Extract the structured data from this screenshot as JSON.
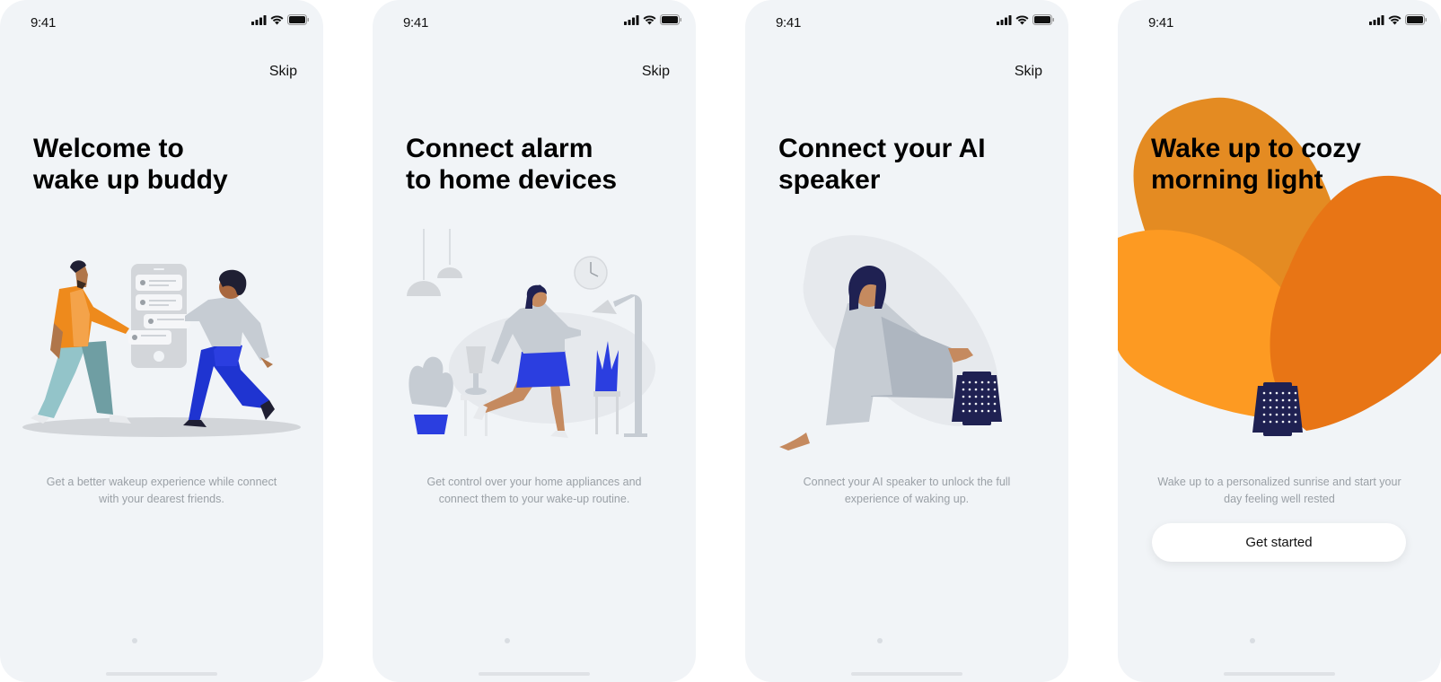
{
  "screens": [
    {
      "time": "9:41",
      "skip": "Skip",
      "title_line1": "Welcome to",
      "title_line2": "wake up buddy",
      "description": "Get a better wakeup experience while connect with your dearest friends.",
      "illustration": "people-exchanging-messages"
    },
    {
      "time": "9:41",
      "skip": "Skip",
      "title_line1": "Connect alarm",
      "title_line2": "to home devices",
      "description": "Get control over your home appliances and connect them to your wake-up routine.",
      "illustration": "woman-in-smart-home"
    },
    {
      "time": "9:41",
      "skip": "Skip",
      "title_line1": "Connect your AI",
      "title_line2": "speaker",
      "description": "Connect your AI speaker to unlock the full experience of waking up.",
      "illustration": "woman-reaching-speaker"
    },
    {
      "time": "9:41",
      "title_line1": "Wake up to cozy",
      "title_line2": "morning light",
      "description": "Wake up to a personalized sunrise and start your day feeling well rested",
      "button": "Get started",
      "illustration": "speaker-with-sunrise-petals"
    }
  ],
  "colors": {
    "background": "#f1f4f7",
    "text": "#000000",
    "muted_text": "#9aa0a6",
    "orange_light": "#fd9a22",
    "orange_mid": "#e48b22",
    "orange_dark": "#e87515",
    "navy": "#1f2152",
    "blue": "#2b3ee0"
  },
  "icons": [
    "signal-icon",
    "wifi-icon",
    "battery-icon"
  ]
}
